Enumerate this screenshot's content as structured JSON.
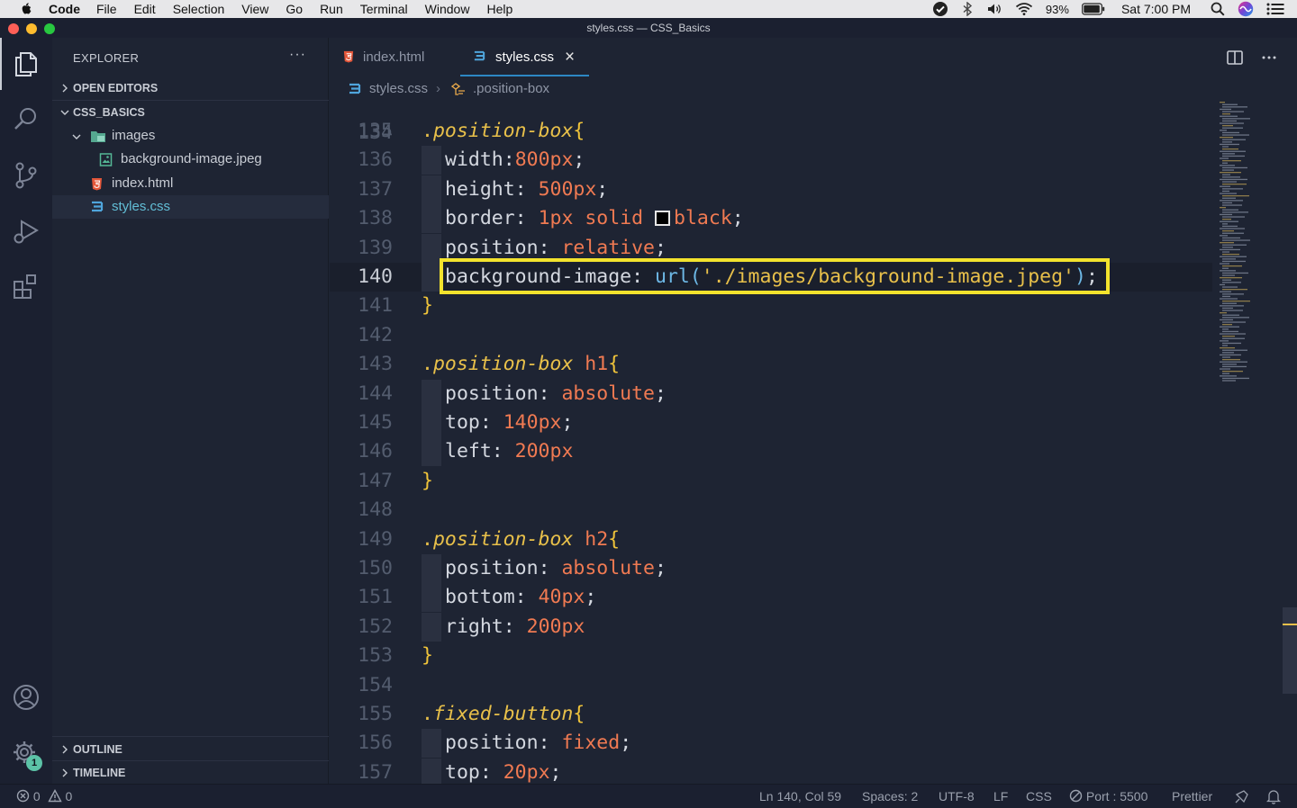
{
  "menubar": {
    "app": "Code",
    "items": [
      "File",
      "Edit",
      "Selection",
      "View",
      "Go",
      "Run",
      "Terminal",
      "Window",
      "Help"
    ],
    "battery": "93%",
    "clock": "Sat 7:00 PM"
  },
  "window": {
    "title": "styles.css — CSS_Basics"
  },
  "sidebar": {
    "header": "EXPLORER",
    "more": "···",
    "open_editors": "OPEN EDITORS",
    "folder": "CSS_BASICS",
    "tree": [
      {
        "label": "images",
        "type": "folder"
      },
      {
        "label": "background-image.jpeg",
        "type": "image"
      },
      {
        "label": "index.html",
        "type": "html"
      },
      {
        "label": "styles.css",
        "type": "css",
        "selected": true
      }
    ],
    "outline": "OUTLINE",
    "timeline": "TIMELINE"
  },
  "activity": {
    "settings_badge": "1"
  },
  "tabs": [
    {
      "label": "index.html",
      "icon": "html-icon"
    },
    {
      "label": "styles.css",
      "icon": "css-icon",
      "active": true,
      "close": "×"
    }
  ],
  "breadcrumb": {
    "file": "styles.css",
    "sep": "›",
    "symbol": ".position-box"
  },
  "editor": {
    "partial_line_number": "134",
    "current_line": 140,
    "lines": [
      {
        "n": "135",
        "tokens": [
          [
            "dot",
            "."
          ],
          [
            "sel",
            "position-box"
          ],
          [
            "brace",
            "{"
          ]
        ]
      },
      {
        "n": "136",
        "guide": true,
        "tokens": [
          [
            "prop",
            "width"
          ],
          [
            "punc",
            ":"
          ],
          [
            "val",
            "800px"
          ],
          [
            "punc",
            ";"
          ]
        ]
      },
      {
        "n": "137",
        "guide": true,
        "tokens": [
          [
            "prop",
            "height"
          ],
          [
            "punc",
            ": "
          ],
          [
            "val",
            "500px"
          ],
          [
            "punc",
            ";"
          ]
        ]
      },
      {
        "n": "138",
        "guide": true,
        "tokens": [
          [
            "prop",
            "border"
          ],
          [
            "punc",
            ": "
          ],
          [
            "val",
            "1px"
          ],
          [
            "punc",
            " "
          ],
          [
            "val",
            "solid"
          ],
          [
            "punc",
            " "
          ],
          [
            "swatch",
            ""
          ],
          [
            "val",
            "black"
          ],
          [
            "punc",
            ";"
          ]
        ]
      },
      {
        "n": "139",
        "guide": true,
        "tokens": [
          [
            "prop",
            "position"
          ],
          [
            "punc",
            ": "
          ],
          [
            "val",
            "relative"
          ],
          [
            "punc",
            ";"
          ]
        ]
      },
      {
        "n": "140",
        "guide": true,
        "tokens": [
          [
            "prop",
            "background-image"
          ],
          [
            "punc",
            ": "
          ],
          [
            "fn",
            "url("
          ],
          [
            "str",
            "'./images/background-image.jpeg'"
          ],
          [
            "fn",
            ")"
          ],
          [
            "punc",
            ";"
          ]
        ]
      },
      {
        "n": "141",
        "tokens": [
          [
            "brace",
            "}"
          ]
        ]
      },
      {
        "n": "142",
        "tokens": []
      },
      {
        "n": "143",
        "tokens": [
          [
            "dot",
            "."
          ],
          [
            "sel",
            "position-box"
          ],
          [
            "punc",
            " "
          ],
          [
            "tag",
            "h1"
          ],
          [
            "brace",
            "{"
          ]
        ]
      },
      {
        "n": "144",
        "guide": true,
        "tokens": [
          [
            "prop",
            "position"
          ],
          [
            "punc",
            ": "
          ],
          [
            "val",
            "absolute"
          ],
          [
            "punc",
            ";"
          ]
        ]
      },
      {
        "n": "145",
        "guide": true,
        "tokens": [
          [
            "prop",
            "top"
          ],
          [
            "punc",
            ": "
          ],
          [
            "val",
            "140px"
          ],
          [
            "punc",
            ";"
          ]
        ]
      },
      {
        "n": "146",
        "guide": true,
        "tokens": [
          [
            "prop",
            "left"
          ],
          [
            "punc",
            ": "
          ],
          [
            "val",
            "200px"
          ]
        ]
      },
      {
        "n": "147",
        "tokens": [
          [
            "brace",
            "}"
          ]
        ]
      },
      {
        "n": "148",
        "tokens": []
      },
      {
        "n": "149",
        "tokens": [
          [
            "dot",
            "."
          ],
          [
            "sel",
            "position-box"
          ],
          [
            "punc",
            " "
          ],
          [
            "tag",
            "h2"
          ],
          [
            "brace",
            "{"
          ]
        ]
      },
      {
        "n": "150",
        "guide": true,
        "tokens": [
          [
            "prop",
            "position"
          ],
          [
            "punc",
            ": "
          ],
          [
            "val",
            "absolute"
          ],
          [
            "punc",
            ";"
          ]
        ]
      },
      {
        "n": "151",
        "guide": true,
        "tokens": [
          [
            "prop",
            "bottom"
          ],
          [
            "punc",
            ": "
          ],
          [
            "val",
            "40px"
          ],
          [
            "punc",
            ";"
          ]
        ]
      },
      {
        "n": "152",
        "guide": true,
        "tokens": [
          [
            "prop",
            "right"
          ],
          [
            "punc",
            ": "
          ],
          [
            "val",
            "200px"
          ]
        ]
      },
      {
        "n": "153",
        "tokens": [
          [
            "brace",
            "}"
          ]
        ]
      },
      {
        "n": "154",
        "tokens": []
      },
      {
        "n": "155",
        "tokens": [
          [
            "dot",
            "."
          ],
          [
            "sel",
            "fixed-button"
          ],
          [
            "brace",
            "{"
          ]
        ]
      },
      {
        "n": "156",
        "guide": true,
        "tokens": [
          [
            "prop",
            "position"
          ],
          [
            "punc",
            ": "
          ],
          [
            "val",
            "fixed"
          ],
          [
            "punc",
            ";"
          ]
        ]
      },
      {
        "n": "157",
        "guide": true,
        "tokens": [
          [
            "prop",
            "top"
          ],
          [
            "punc",
            ": "
          ],
          [
            "val",
            "20px"
          ],
          [
            "punc",
            ";"
          ]
        ]
      }
    ]
  },
  "statusbar": {
    "errors": "0",
    "warnings": "0",
    "cursor": "Ln 140, Col 59",
    "spaces": "Spaces: 2",
    "encoding": "UTF-8",
    "eol": "LF",
    "language": "CSS",
    "port": "Port : 5500",
    "formatter": "Prettier"
  },
  "colors": {
    "accent": "#2d87c4",
    "highlight_box": "#f3e32d",
    "selector": "#e8c04a",
    "value": "#f07a52",
    "function": "#6db8e6"
  }
}
